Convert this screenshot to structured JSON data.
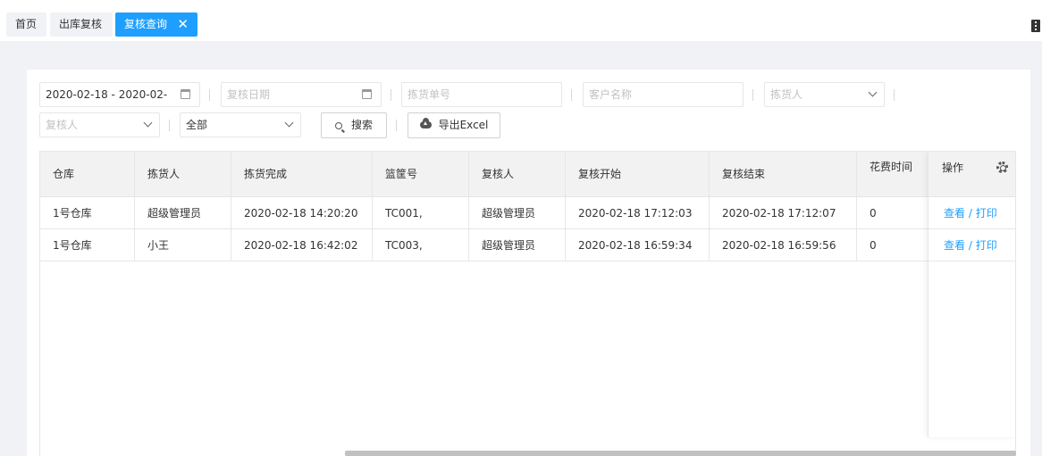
{
  "tabs": {
    "home": "首页",
    "outbound_review": "出库复核",
    "review_query": "复核查询",
    "close": "✕"
  },
  "filters": {
    "date_range_value": "2020-02-18 - 2020-02-",
    "review_date_placeholder": "复核日期",
    "picking_no_placeholder": "拣货单号",
    "customer_name_placeholder": "客户名称",
    "picker_placeholder": "拣货人",
    "reviewer_placeholder": "复核人",
    "status_value": "全部",
    "search_label": "搜索",
    "export_label": "导出Excel"
  },
  "table": {
    "columns": [
      "仓库",
      "拣货人",
      "拣货完成",
      "篮筐号",
      "复核人",
      "复核开始",
      "复核结束",
      "花费时间"
    ],
    "action_header": "操作",
    "rows": [
      [
        "1号仓库",
        "超级管理员",
        "2020-02-18 14:20:20",
        "TC001,",
        "超级管理员",
        "2020-02-18 17:12:03",
        "2020-02-18 17:12:07",
        "0"
      ],
      [
        "1号仓库",
        "小王",
        "2020-02-18 16:42:02",
        "TC003,",
        "超级管理员",
        "2020-02-18 16:59:34",
        "2020-02-18 16:59:56",
        "0"
      ]
    ],
    "actions": [
      {
        "view": "查看",
        "sep": " / ",
        "print": "打印"
      },
      {
        "view": "查看",
        "sep": " / ",
        "print": "打印"
      }
    ]
  },
  "colors": {
    "accent": "#1e9fff",
    "header_bg": "#f2f2f2",
    "page_bg": "#f0f2f5"
  }
}
